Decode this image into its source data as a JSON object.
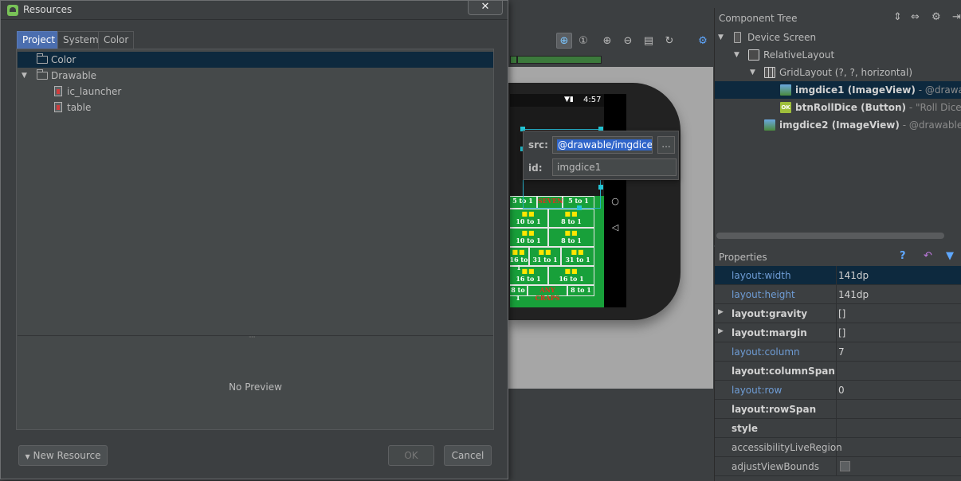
{
  "dialog": {
    "title": "Resources",
    "close_label": "✕",
    "tabs": [
      {
        "label": "Project",
        "active": true
      },
      {
        "label": "System",
        "active": false
      },
      {
        "label": "Color",
        "active": false
      }
    ],
    "tree": [
      {
        "label": "Color",
        "type": "folder",
        "expanded": false,
        "selected": true
      },
      {
        "label": "Drawable",
        "type": "folder",
        "expanded": true,
        "selected": false
      },
      {
        "label": "ic_launcher",
        "type": "file",
        "selected": false
      },
      {
        "label": "table",
        "type": "file",
        "selected": false
      }
    ],
    "preview_text": "No Preview",
    "new_resource_label": "New Resource",
    "ok_label": "OK",
    "cancel_label": "Cancel"
  },
  "designer": {
    "status_time": "4:57",
    "table_cells": [
      "5 to 1",
      "SEVEN",
      "5 to 1",
      "10 to 1",
      "8 to 1",
      "10 to 1",
      "8 to 1",
      "16 to 1",
      "31 to 1",
      "31 to 1",
      "16 to 1",
      "16 to 1",
      "8 to 1",
      "ANY CRAPS",
      "8 to 1"
    ],
    "inline_editor": {
      "src_label": "src:",
      "src_value": "@drawable/imgdice1",
      "more_label": "...",
      "id_label": "id:",
      "id_value": "imgdice1"
    }
  },
  "component_tree": {
    "title": "Component Tree",
    "items": [
      {
        "name": "Device Screen",
        "suffix": "",
        "bold": false
      },
      {
        "name": "RelativeLayout",
        "suffix": "",
        "bold": false
      },
      {
        "name": "GridLayout (?, ?, horizontal)",
        "suffix": "",
        "bold": false
      },
      {
        "name": "imgdice1 (ImageView)",
        "suffix": " - @drawable/im",
        "bold": true,
        "selected": true
      },
      {
        "name": "btnRollDice (Button)",
        "suffix": " - \"Roll Dice\"",
        "bold": true
      },
      {
        "name": "imgdice2 (ImageView)",
        "suffix": " - @drawable/imgdic",
        "bold": true
      }
    ]
  },
  "properties": {
    "title": "Properties",
    "rows": [
      {
        "name": "layout:width",
        "value": "141dp",
        "style": "blue",
        "selected": true
      },
      {
        "name": "layout:height",
        "value": "141dp",
        "style": "blue"
      },
      {
        "name": "layout:gravity",
        "value": "[]",
        "style": "bold",
        "expandable": true
      },
      {
        "name": "layout:margin",
        "value": "[]",
        "style": "bold",
        "expandable": true
      },
      {
        "name": "layout:column",
        "value": "7",
        "style": "blue"
      },
      {
        "name": "layout:columnSpan",
        "value": "",
        "style": "bold"
      },
      {
        "name": "layout:row",
        "value": "0",
        "style": "blue"
      },
      {
        "name": "layout:rowSpan",
        "value": "",
        "style": "bold"
      },
      {
        "name": "style",
        "value": "",
        "style": "bold"
      },
      {
        "name": "accessibilityLiveRegion",
        "value": "",
        "style": "plain"
      },
      {
        "name": "adjustViewBounds",
        "value": "",
        "style": "plain",
        "checkbox": true
      }
    ]
  },
  "colors": {
    "panel_bg": "#3c3f41",
    "selection_bg": "#0d293e",
    "active_tab": "#4b6eaf",
    "felt_green": "#18a03a"
  }
}
